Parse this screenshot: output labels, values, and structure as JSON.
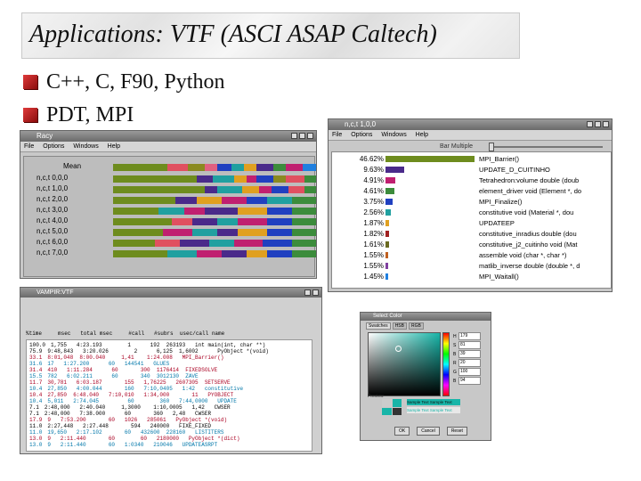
{
  "slide": {
    "title": "Applications: VTF (ASCI ASAP Caltech)",
    "bullets": [
      "C++, C, F90, Python",
      "PDT, MPI"
    ]
  },
  "racy": {
    "title": "Racy",
    "menu": [
      "File",
      "Options",
      "Windows",
      "Help"
    ],
    "rows": [
      "Mean",
      "n,c,t 0,0,0",
      "n,c,t 1,0,0",
      "n,c,t 2,0,0",
      "n,c,t 3,0,0",
      "n,c,t 4,0,0",
      "n,c,t 5,0,0",
      "n,c,t 6,0,0",
      "n,c,t 7,0,0"
    ]
  },
  "profile": {
    "title": "n,c,t 1,0,0",
    "menu": [
      "File",
      "Options",
      "Windows",
      "Help"
    ],
    "slider_label": "Bar Multiple",
    "entries": [
      {
        "pct": "46.62%",
        "label": "MPI_Barrier()",
        "color": "#6e8c1e",
        "frac": 1.0
      },
      {
        "pct": "9.63%",
        "label": "UPDATE_D_CUITINHO",
        "color": "#4a2a8a",
        "frac": 0.21
      },
      {
        "pct": "4.91%",
        "label": "Tetrahedron:volume double (doub",
        "color": "#c02070",
        "frac": 0.11
      },
      {
        "pct": "4.61%",
        "label": "element_driver void (Element *, do",
        "color": "#3c8c3c",
        "frac": 0.1
      },
      {
        "pct": "3.75%",
        "label": "MPI_Finalize()",
        "color": "#2040c0",
        "frac": 0.08
      },
      {
        "pct": "2.56%",
        "label": "constitutive void (Material *, dou",
        "color": "#20a0a0",
        "frac": 0.06
      },
      {
        "pct": "1.87%",
        "label": "UPDATEEP",
        "color": "#e0a020",
        "frac": 0.04
      },
      {
        "pct": "1.82%",
        "label": "constitutive_inradius double (dou",
        "color": "#a02020",
        "frac": 0.04
      },
      {
        "pct": "1.61%",
        "label": "constitutive_j2_cuitinho void (Mat",
        "color": "#6a6a20",
        "frac": 0.035
      },
      {
        "pct": "1.55%",
        "label": "assemble void (char *, char *)",
        "color": "#c06020",
        "frac": 0.033
      },
      {
        "pct": "1.55%",
        "label": "matlib_inverse double (double *, d",
        "color": "#8040a0",
        "frac": 0.033
      },
      {
        "pct": "1.45%",
        "label": "MPI_Waitall()",
        "color": "#2080e0",
        "frac": 0.031
      }
    ]
  },
  "table_win": {
    "title": "VAMPIR:VTF",
    "header": "%time     msec   total msec     #call   #subrs  usec/call name",
    "rows": [
      {
        "t": "100.0",
        "r": "1,755   4:23.193        1      192  263193   int main(int, char **)",
        "c": "#000"
      },
      {
        "t": "75.9",
        "r": "9:48,843   3:20.026        2      6,125  1,6002      PyObject *(void)",
        "c": "#000"
      },
      {
        "t": "33.1",
        "r": "8:01,048  8:00.040     1,41    1:24.008   MPI_Barrier()",
        "c": "#a02"
      },
      {
        "t": "31.6",
        "r": "17   1:27.200      60   144541   GLUES",
        "c": "#07a"
      },
      {
        "t": "31.4",
        "r": "410   1:11.284      60       300  1176414  FIXEDSOLVE",
        "c": "#a02"
      },
      {
        "t": "15.5",
        "r": "782   6:02.211      60       340  3012130  ZAVE",
        "c": "#07a"
      },
      {
        "t": "11.7",
        "r": "30,781   6:03.187       155   1,76225   2607305  SETSERVE",
        "c": "#a02"
      },
      {
        "t": "10.4",
        "r": "27,850   4:00.044       160   7:10,0405   1:42   constitutive",
        "c": "#07a"
      },
      {
        "t": "10.4",
        "r": "27,850  6:48.040   7:10,010   1:34,000       11   PYOBJECT",
        "c": "#a02"
      },
      {
        "t": "10.4",
        "r": "5,011   2:74.045         60        360   7:44,0000   UPDATE",
        "c": "#07a"
      },
      {
        "t": "7.1",
        "r": "2:48,000   2:40.040     1,3000    1:10,0005   1,42   CWSER",
        "c": "#000"
      },
      {
        "t": "7.1",
        "r": "2:48,000   7:38.000      60       360   2,48   CWSER",
        "c": "#000"
      },
      {
        "t": "17.9",
        "r": "9   7:53.200       60   1026   285061   PyObject *(void)",
        "c": "#a02"
      },
      {
        "t": "11.0",
        "r": "2:27,448   2:27.448       594   240000   FIXE_FIXED",
        "c": "#000"
      },
      {
        "t": "11.0",
        "r": "19,650   2:17.102       60   432600  228160   LISTITERS",
        "c": "#07a"
      },
      {
        "t": "13.0",
        "r": "9   2:11.440       60        60   2180000   PyObject *(dict)",
        "c": "#a02"
      },
      {
        "t": "13.0",
        "r": "9   2:11.440       60   1:0340   210046   UPDATEASRPT",
        "c": "#07a"
      }
    ]
  },
  "color_win": {
    "title": "Select Color",
    "tabs": [
      "Swatches",
      "HSB",
      "RGB"
    ],
    "preview_label": "Preview",
    "sample_text": "Sample Text Sample Text",
    "buttons": [
      "OK",
      "Cancel",
      "Reset"
    ],
    "fields": [
      "H",
      "S",
      "B",
      "R",
      "G",
      "B"
    ],
    "values": [
      "179",
      "81",
      "39",
      "20",
      "100",
      "94"
    ]
  }
}
